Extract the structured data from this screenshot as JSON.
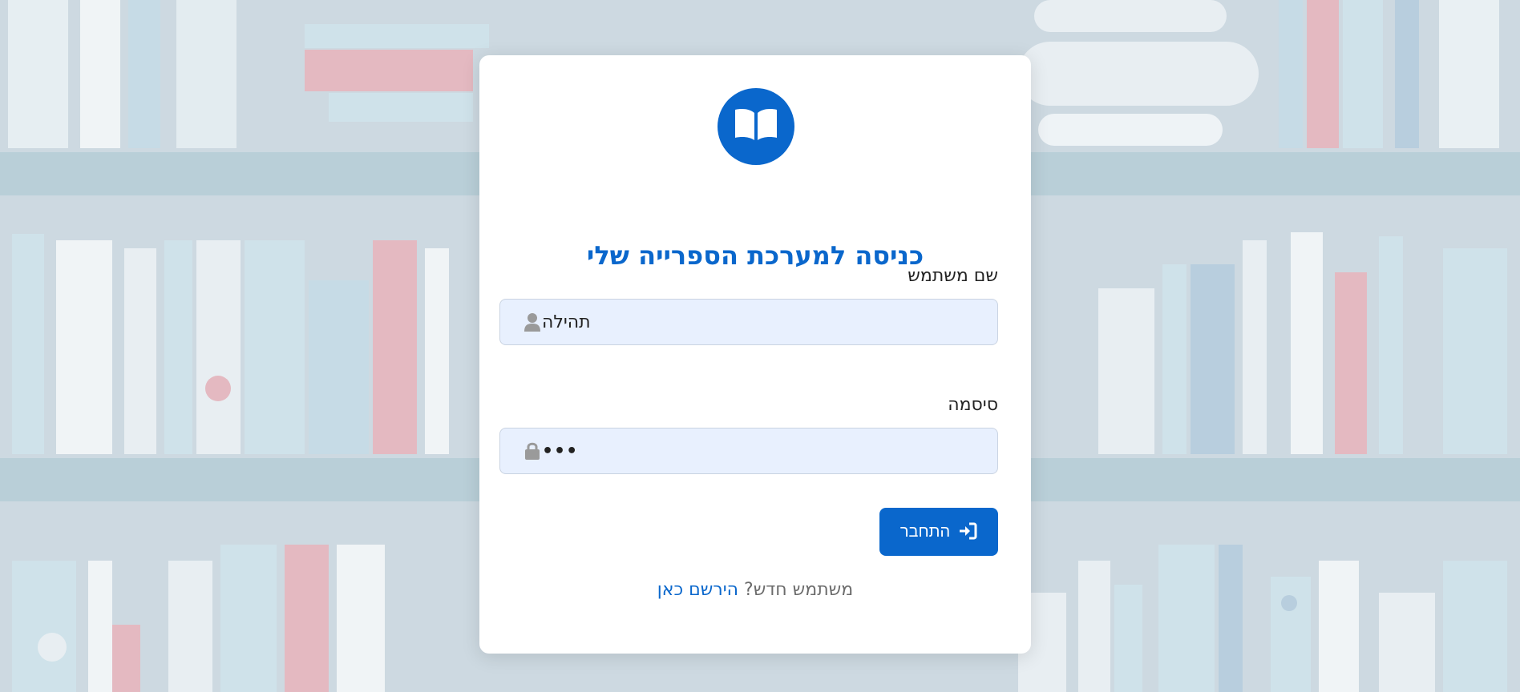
{
  "colors": {
    "accent": "#0a67cc",
    "input_bg": "#e8f0fe",
    "background": "#c9d7df",
    "muted_text": "#6c6c6c"
  },
  "logo": {
    "icon": "open-book-icon"
  },
  "login_form": {
    "title": "כניסה למערכת הספרייה שלי",
    "username": {
      "label": "שם משתמש",
      "value": "תהילה",
      "icon": "user-icon"
    },
    "password": {
      "label": "סיסמה",
      "value": "•••",
      "icon": "lock-icon"
    },
    "submit": {
      "label": "התחבר",
      "icon": "sign-in-icon"
    },
    "register": {
      "prompt": "משתמש חדש?",
      "link_label": "הירשם כאן"
    }
  }
}
